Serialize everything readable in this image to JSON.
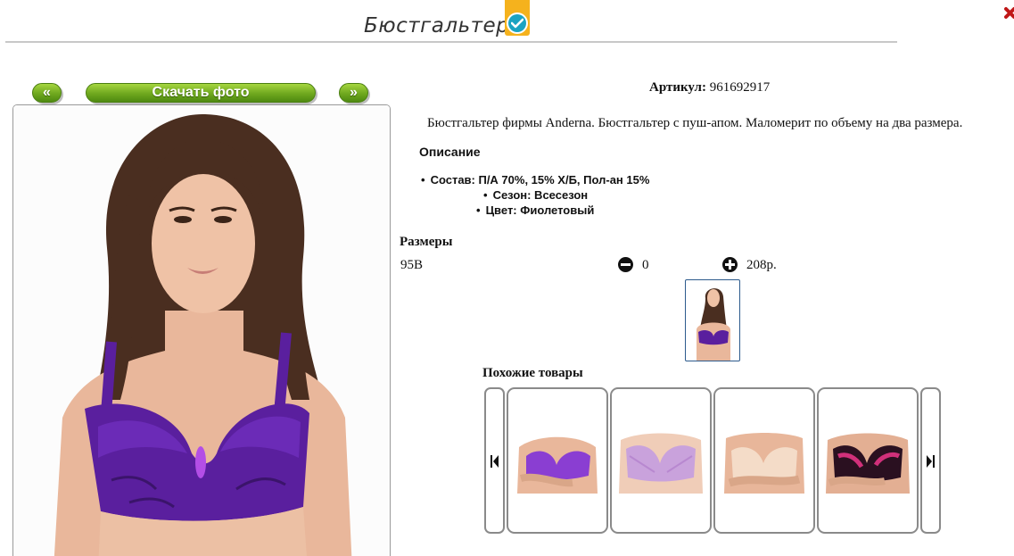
{
  "header": {
    "title": "Бюстгальтер"
  },
  "photo_nav": {
    "prev_label": "«",
    "download_label": "Скачать фото",
    "next_label": "»"
  },
  "product": {
    "article_label": "Артикул:",
    "article_value": "961692917",
    "description": "Бюстгальтер фирмы Anderna. Бюстгальтер с пуш-апом. Маломерит по объему на два размера.",
    "details_heading": "Описание",
    "details": [
      "Состав: П/А 70%, 15% Х/Б, Пол-ан 15%",
      "Сезон: Всесезон",
      "Цвет: Фиолетовый"
    ]
  },
  "sizes": {
    "heading": "Размеры",
    "rows": [
      {
        "size": "95B",
        "quantity": "0",
        "price": "208р."
      }
    ]
  },
  "similar": {
    "heading": "Похожие товары"
  },
  "colors": {
    "accent_green": "#6fa81e",
    "badge_yellow": "#f5b21d",
    "badge_teal": "#1ba3c2",
    "product_purple": "#5a1f9e"
  },
  "icons": {
    "verified": "check-circle-icon",
    "minus": "minus-circle-icon",
    "plus": "plus-circle-icon",
    "carousel_prev": "skip-previous-icon",
    "carousel_next": "skip-next-icon",
    "close": "close-icon"
  }
}
